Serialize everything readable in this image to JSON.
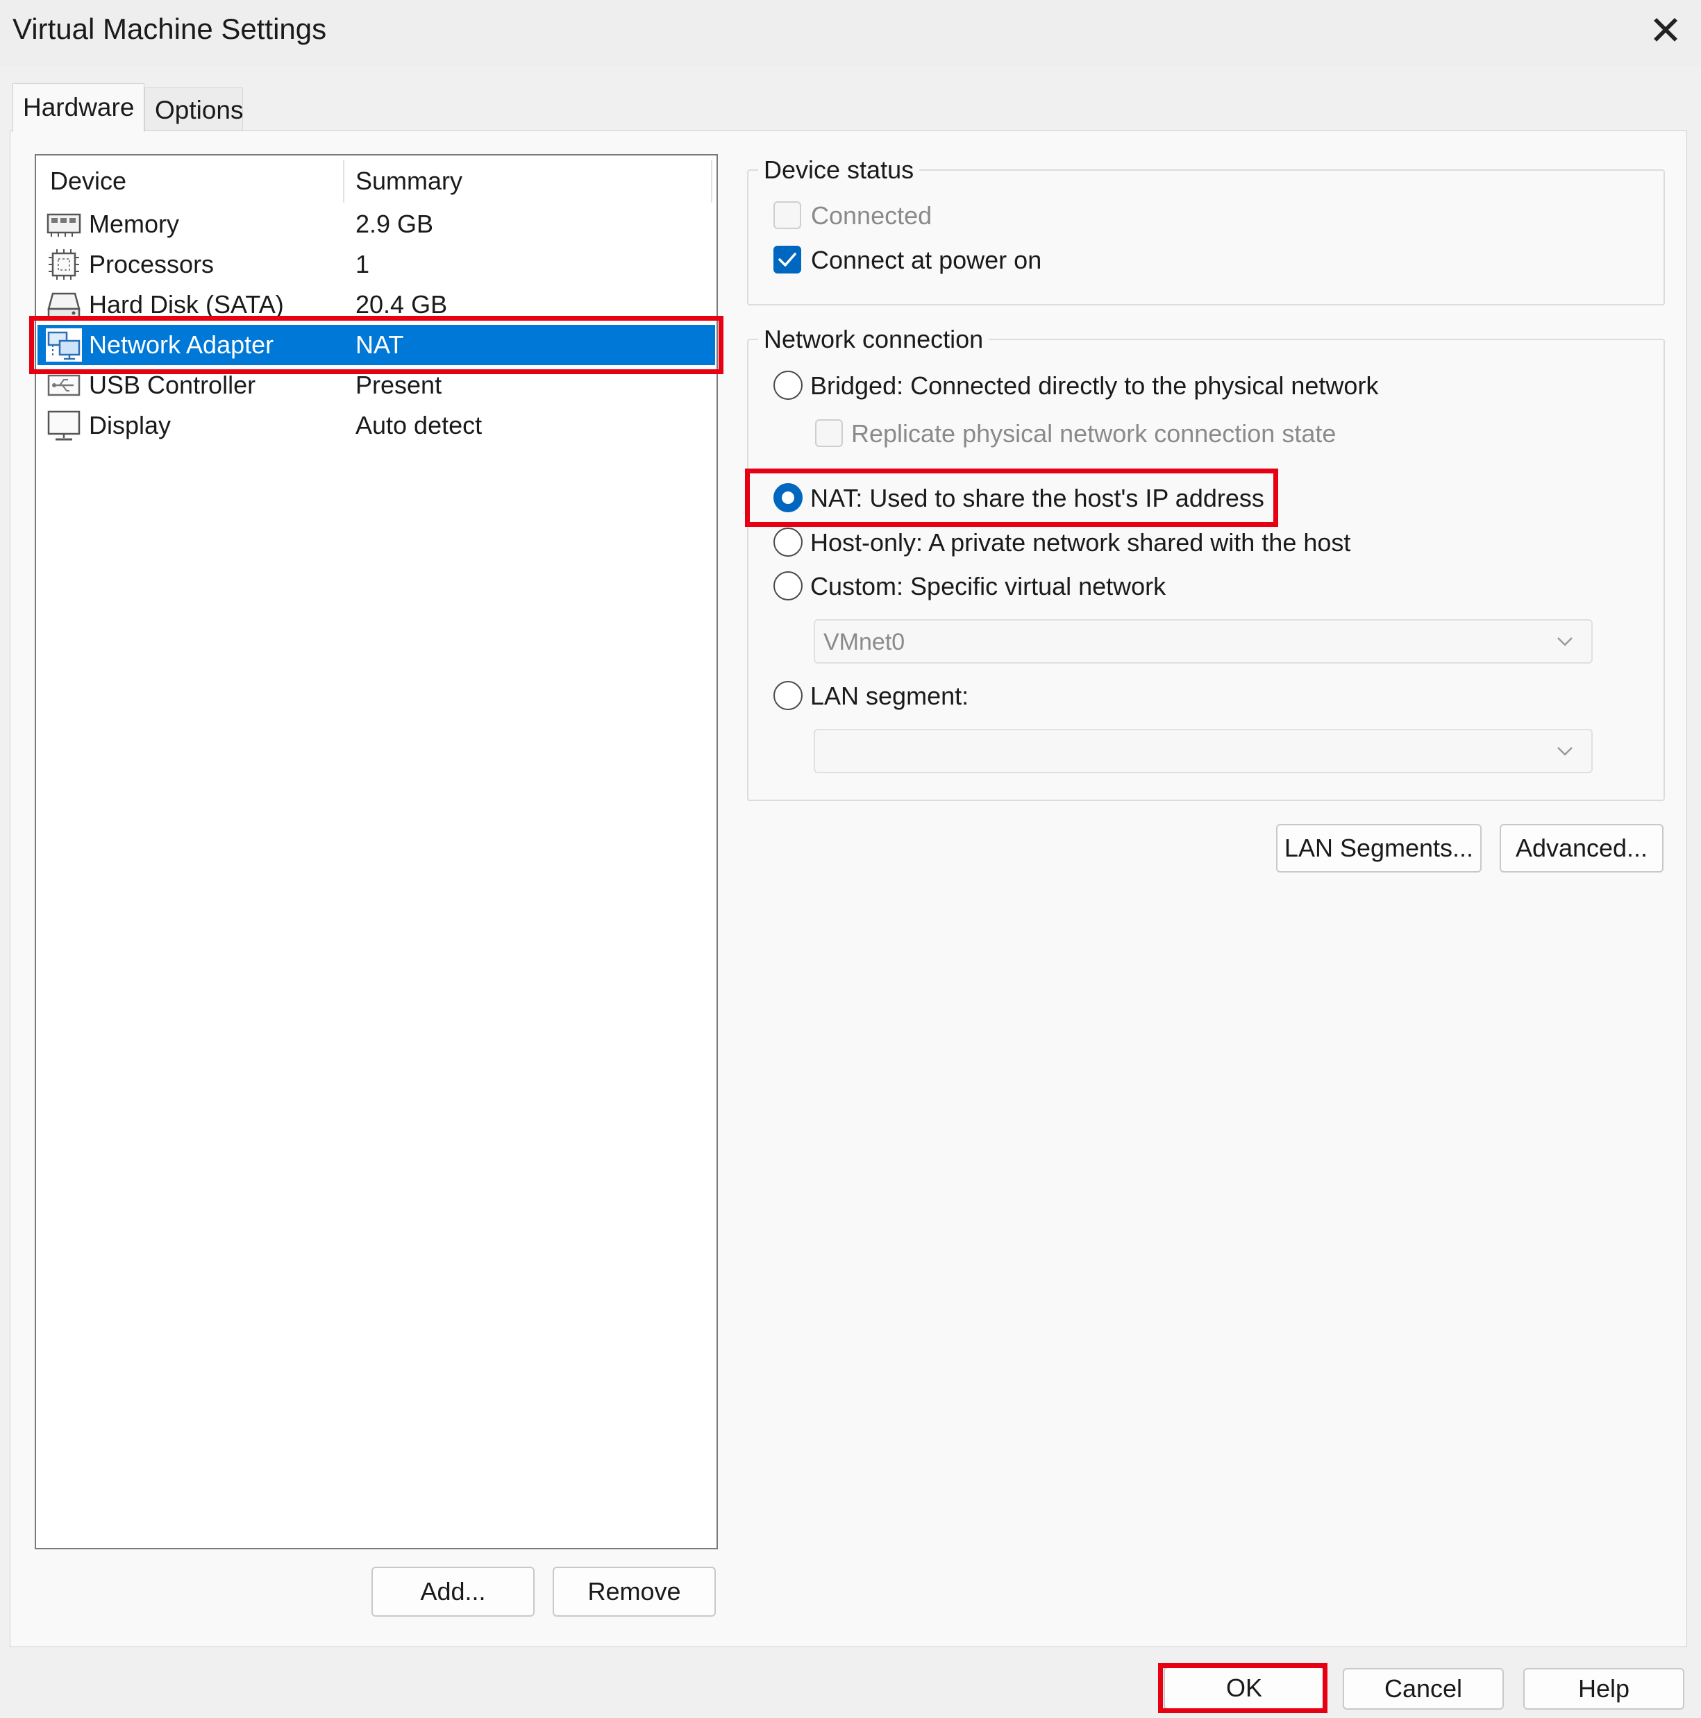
{
  "window": {
    "title": "Virtual Machine Settings"
  },
  "tabs": [
    {
      "label": "Hardware",
      "selected": true
    },
    {
      "label": "Options",
      "selected": false
    }
  ],
  "device_list": {
    "columns": [
      "Device",
      "Summary"
    ],
    "rows": [
      {
        "icon": "memory-icon",
        "device": "Memory",
        "summary": "2.9 GB"
      },
      {
        "icon": "processor-icon",
        "device": "Processors",
        "summary": "1"
      },
      {
        "icon": "hard-disk-icon",
        "device": "Hard Disk (SATA)",
        "summary": "20.4 GB"
      },
      {
        "icon": "network-adapter-icon",
        "device": "Network Adapter",
        "summary": "NAT",
        "selected": true
      },
      {
        "icon": "usb-icon",
        "device": "USB Controller",
        "summary": "Present"
      },
      {
        "icon": "display-icon",
        "device": "Display",
        "summary": "Auto detect"
      }
    ],
    "add_label": "Add...",
    "remove_label": "Remove"
  },
  "device_status": {
    "title": "Device status",
    "connected": {
      "label": "Connected",
      "checked": false,
      "enabled": false
    },
    "connect_at_power_on": {
      "label": "Connect at power on",
      "checked": true,
      "enabled": true
    }
  },
  "network_connection": {
    "title": "Network connection",
    "bridged": {
      "label": "Bridged: Connected directly to the physical network",
      "selected": false
    },
    "replicate": {
      "label": "Replicate physical network connection state",
      "checked": false,
      "enabled": false
    },
    "nat": {
      "label": "NAT: Used to share the host's IP address",
      "selected": true
    },
    "host_only": {
      "label": "Host-only: A private network shared with the host",
      "selected": false
    },
    "custom": {
      "label": "Custom: Specific virtual network",
      "selected": false
    },
    "custom_network_value": "VMnet0",
    "lan_segment": {
      "label": "LAN segment:",
      "selected": false
    },
    "lan_segment_value": ""
  },
  "panel_buttons": {
    "lan_segments": "LAN Segments...",
    "advanced": "Advanced..."
  },
  "dialog_buttons": {
    "ok": "OK",
    "cancel": "Cancel",
    "help": "Help"
  },
  "colors": {
    "selection": "#0078d7",
    "accent": "#0067c0",
    "highlight": "#e60012"
  }
}
